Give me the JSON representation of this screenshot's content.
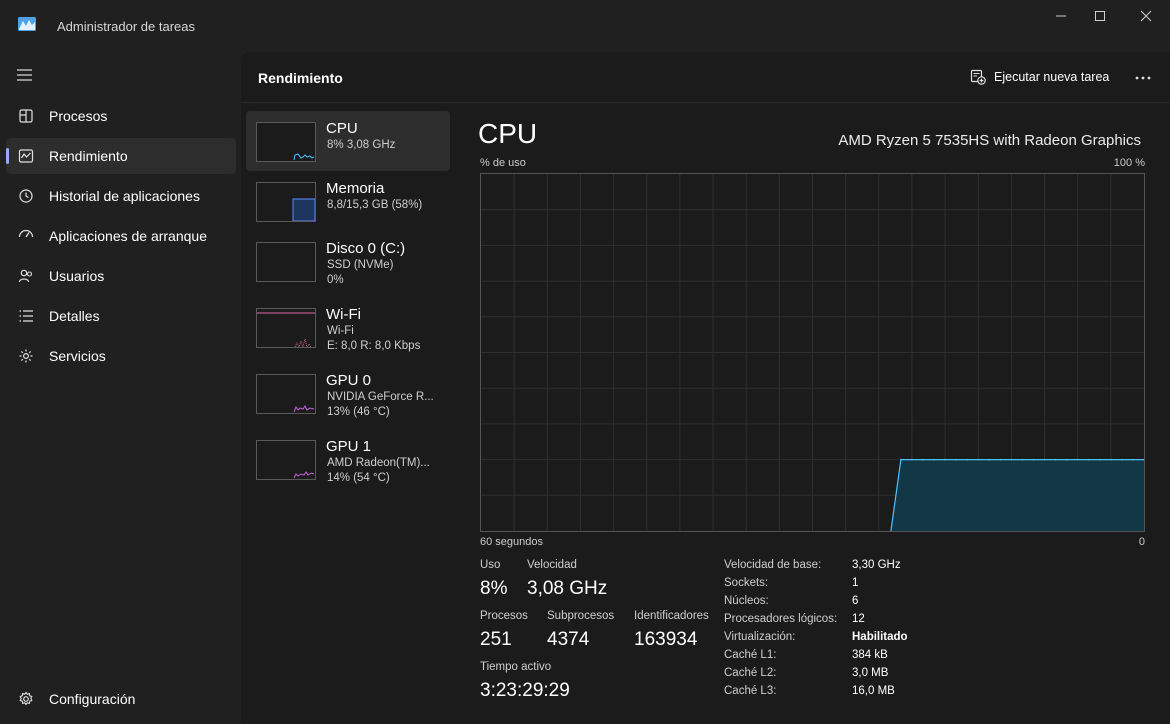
{
  "window": {
    "title": "Administrador de tareas"
  },
  "nav": {
    "items": [
      {
        "label": "Procesos",
        "icon": "processes-icon"
      },
      {
        "label": "Rendimiento",
        "icon": "performance-icon",
        "active": true
      },
      {
        "label": "Historial de aplicaciones",
        "icon": "history-icon"
      },
      {
        "label": "Aplicaciones de arranque",
        "icon": "startup-icon"
      },
      {
        "label": "Usuarios",
        "icon": "users-icon"
      },
      {
        "label": "Detalles",
        "icon": "details-icon"
      },
      {
        "label": "Servicios",
        "icon": "services-icon"
      }
    ],
    "settings_label": "Configuración"
  },
  "header": {
    "title": "Rendimiento",
    "run_task_label": "Ejecutar nueva tarea"
  },
  "devices": [
    {
      "name": "CPU",
      "line1": "8% 3,08 GHz",
      "line2": "",
      "color": "#4cc2ff",
      "active": true
    },
    {
      "name": "Memoria",
      "line1": "8,8/15,3 GB (58%)",
      "line2": "",
      "color": "#5b8cff"
    },
    {
      "name": "Disco 0 (C:)",
      "line1": "SSD (NVMe)",
      "line2": "0%",
      "color": "#6dbb4a"
    },
    {
      "name": "Wi-Fi",
      "line1": "Wi-Fi",
      "line2": "E: 8,0 R: 8,0 Kbps",
      "color": "#e36ba7"
    },
    {
      "name": "GPU 0",
      "line1": "NVIDIA GeForce R...",
      "line2": "13% (46 °C)",
      "color": "#c55fe0"
    },
    {
      "name": "GPU 1",
      "line1": "AMD Radeon(TM)...",
      "line2": "14% (54 °C)",
      "color": "#c55fe0"
    }
  ],
  "cpu": {
    "title": "CPU",
    "model": "AMD Ryzen 5 7535HS with Radeon Graphics",
    "y_label": "% de uso",
    "y_max_label": "100 %",
    "x_left_label": "60 segundos",
    "x_right_label": "0",
    "line_color": "#4cc2ff"
  },
  "chart_data": {
    "type": "area",
    "xlabel": "60 segundos",
    "ylabel": "% de uso",
    "ylim": [
      0,
      100
    ],
    "xlim": [
      60,
      0
    ],
    "grid": true,
    "x": [
      22,
      21,
      20,
      19,
      18,
      17,
      16,
      15,
      14,
      13,
      12,
      11,
      10,
      9,
      8,
      7,
      6,
      5,
      4,
      3,
      2,
      1,
      0
    ],
    "values": [
      20,
      20,
      20,
      20,
      20,
      20,
      20,
      20,
      20,
      20,
      20,
      20,
      20,
      20,
      20,
      20,
      20,
      20,
      20,
      20,
      20,
      20,
      20
    ]
  },
  "stats": {
    "uso_label": "Uso",
    "uso_value": "8%",
    "velocidad_label": "Velocidad",
    "velocidad_value": "3,08 GHz",
    "procesos_label": "Procesos",
    "procesos_value": "251",
    "subprocesos_label": "Subprocesos",
    "subprocesos_value": "4374",
    "identificadores_label": "Identificadores",
    "identificadores_value": "163934",
    "tiempo_label": "Tiempo activo",
    "tiempo_value": "3:23:29:29"
  },
  "specs": [
    {
      "label": "Velocidad de base:",
      "value": "3,30 GHz",
      "bold": false
    },
    {
      "label": "Sockets:",
      "value": "1",
      "bold": false
    },
    {
      "label": "Núcleos:",
      "value": "6",
      "bold": false
    },
    {
      "label": "Procesadores lógicos:",
      "value": "12",
      "bold": false
    },
    {
      "label": "Virtualización:",
      "value": "Habilitado",
      "bold": true
    },
    {
      "label": "Caché L1:",
      "value": "384 kB",
      "bold": false
    },
    {
      "label": "Caché L2:",
      "value": "3,0 MB",
      "bold": false
    },
    {
      "label": "Caché L3:",
      "value": "16,0 MB",
      "bold": false
    }
  ]
}
